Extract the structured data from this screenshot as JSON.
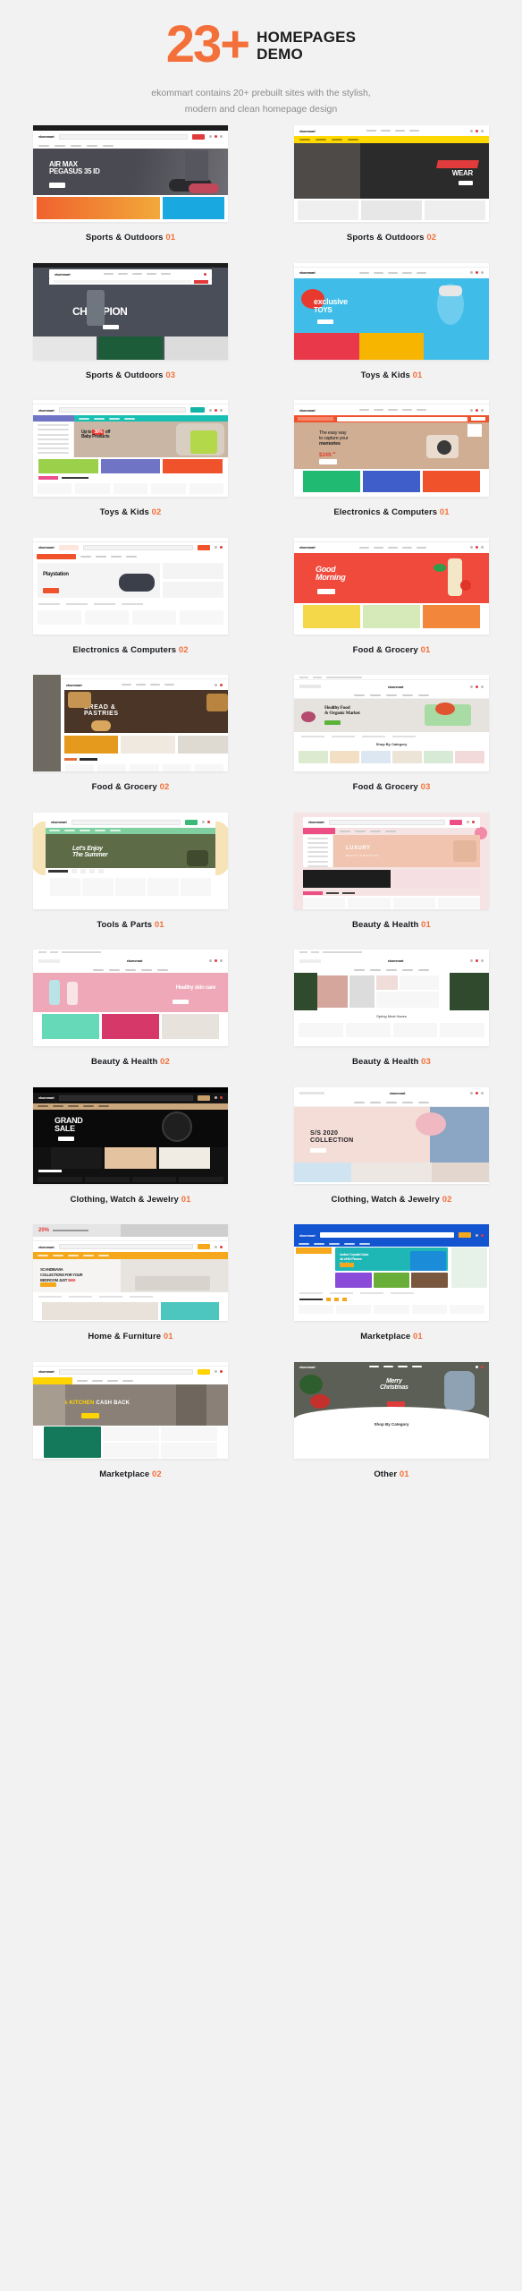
{
  "header": {
    "count": "23+",
    "title_line1": "HOMEPAGES",
    "title_line2": "DEMO",
    "subtitle_line1": "ekommart contains 20+ prebuilt sites with the stylish,",
    "subtitle_line2": "modern and clean homepage design",
    "accent_color": "#f4703a",
    "background_color": "#f2f2f2"
  },
  "demos": [
    {
      "name": "Sports & Outdoors",
      "number": "01",
      "hero_text": "AIR MAX PEGASUS 35 ID",
      "cta": "Shop Now"
    },
    {
      "name": "Sports & Outdoors",
      "number": "02",
      "hero_text": "SPORTS WEAR",
      "cta": "Shop Now"
    },
    {
      "name": "Sports & Outdoors",
      "number": "03",
      "hero_text": "CHAMPION",
      "cta": "Shop Now"
    },
    {
      "name": "Toys & Kids",
      "number": "01",
      "hero_text": "exclusive TOYS",
      "cta": "Shop Now"
    },
    {
      "name": "Toys & Kids",
      "number": "02",
      "hero_text": "Up to 30% off Baby Products",
      "cta": "Shop Now"
    },
    {
      "name": "Electronics & Computers",
      "number": "01",
      "hero_text": "The easy way to capture your memories",
      "cta": "Check It Out"
    },
    {
      "name": "Electronics & Computers",
      "number": "02",
      "hero_text": "Get Ready For Playstation",
      "cta": "Shop Now"
    },
    {
      "name": "Food & Grocery",
      "number": "01",
      "hero_text": "Good Morning",
      "cta": "Shop Now"
    },
    {
      "name": "Food & Grocery",
      "number": "02",
      "hero_text": "BREAD & PASTRIES",
      "cta": "Shop Now"
    },
    {
      "name": "Food & Grocery",
      "number": "03",
      "hero_text": "Healthy Food & Organic Market",
      "cta": "Shop Now"
    },
    {
      "name": "Tools & Parts",
      "number": "01",
      "hero_text": "Let's Enjoy The Summer",
      "cta": "Shop Now"
    },
    {
      "name": "Beauty & Health",
      "number": "01",
      "hero_text": "LUXURY BEAUTY PRODUCTS",
      "cta": "Shop Now"
    },
    {
      "name": "Beauty & Health",
      "number": "02",
      "hero_text": "Healthy skin care",
      "cta": "Shop Now"
    },
    {
      "name": "Beauty & Health",
      "number": "03",
      "hero_text": "Spring Must Haves",
      "cta": "Shop Now"
    },
    {
      "name": "Clothing, Watch & Jewelry",
      "number": "01",
      "hero_text": "GRAND SALE",
      "cta": "Shop Now"
    },
    {
      "name": "Clothing, Watch & Jewelry",
      "number": "02",
      "hero_text": "S/S 2020 COLLECTION",
      "cta": "Shop Now"
    },
    {
      "name": "Home & Furniture",
      "number": "01",
      "hero_text": "SCANDINAVIA COLLECTIONS FOR YOUR BEDROOM JUST $699",
      "cta": "Shop Now"
    },
    {
      "name": "Marketplace",
      "number": "01",
      "hero_text": "Active Crystal Color 4k UHD Picture Quality",
      "cta": "Shop Now"
    },
    {
      "name": "Marketplace",
      "number": "02",
      "hero_text": "10% KITCHEN CASH BACK",
      "cta": "Shop Now"
    },
    {
      "name": "Other",
      "number": "01",
      "hero_text": "Merry Christmas",
      "cta": "Shop Now"
    }
  ]
}
